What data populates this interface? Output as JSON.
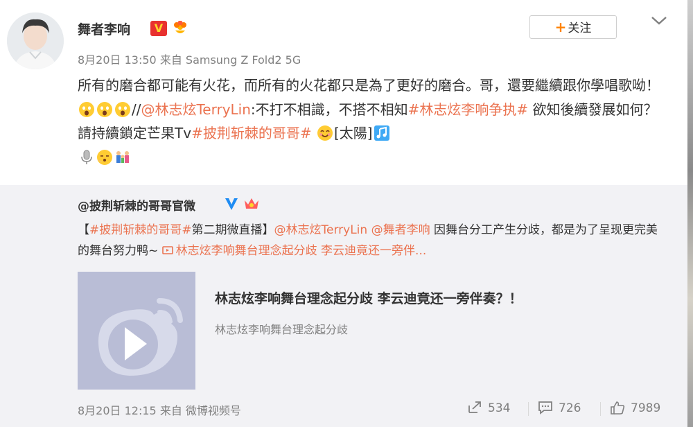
{
  "post": {
    "username": "舞者李响",
    "verified_badge": "V",
    "meta": "8月20日 13:50 来自 Samsung Z Fold2 5G",
    "follow_label": "关注",
    "content": {
      "text1": "所有的磨合都可能有火花，而所有的火花都只是為了更好的磨合。哥，還要繼續跟你學唱歌呦！",
      "text2": "//",
      "mention1": "@林志炫TerryLin",
      "text3": ":不打不相識，不搭不相知",
      "hashtag1": "#林志炫李响争执#",
      "text4": " 欲知後續發展如何？請持續鎖定芒果Tv",
      "hashtag2": "#披荆斩棘的哥哥#",
      "text5": "[太陽]"
    }
  },
  "repost": {
    "author": "@披荆斩棘的哥哥官微",
    "text": {
      "p1": "【",
      "hashtag": "#披荆斩棘的哥哥#",
      "p2": "第二期微直播】",
      "mention1": "@林志炫TerryLin",
      "p3": " ",
      "mention2": "@舞者李响",
      "p4": " 因舞台分工产生分歧，都是为了呈现更完美的舞台努力鸭~ ",
      "video_link": "林志炫李响舞台理念起分歧 李云迪竟还一旁伴..."
    },
    "card": {
      "title": "林志炫李响舞台理念起分歧 李云迪竟还一旁伴奏？！",
      "subtitle": "林志炫李响舞台理念起分歧"
    },
    "meta": "8月20日 12:15 来自 微博视频号",
    "actions": {
      "repost_count": "534",
      "comment_count": "726",
      "like_count": "7989"
    }
  },
  "colors": {
    "link": "#eb7350",
    "follow_plus": "#ff8200",
    "repost_bg": "#f2f2f5",
    "card_bg": "#b9bdd6"
  },
  "icons": [
    "avatar",
    "vip-badge-icon",
    "flower-badge-icon",
    "chevron-down-icon",
    "fearful-emoji-icon",
    "smile-emoji-icon",
    "music-note-icon",
    "microphone-icon",
    "blushing-emoji-icon",
    "family-emoji-icon",
    "verified-blue-icon",
    "crown-badge-icon",
    "video-link-icon",
    "weibo-play-icon",
    "repost-icon",
    "comment-icon",
    "like-icon"
  ]
}
